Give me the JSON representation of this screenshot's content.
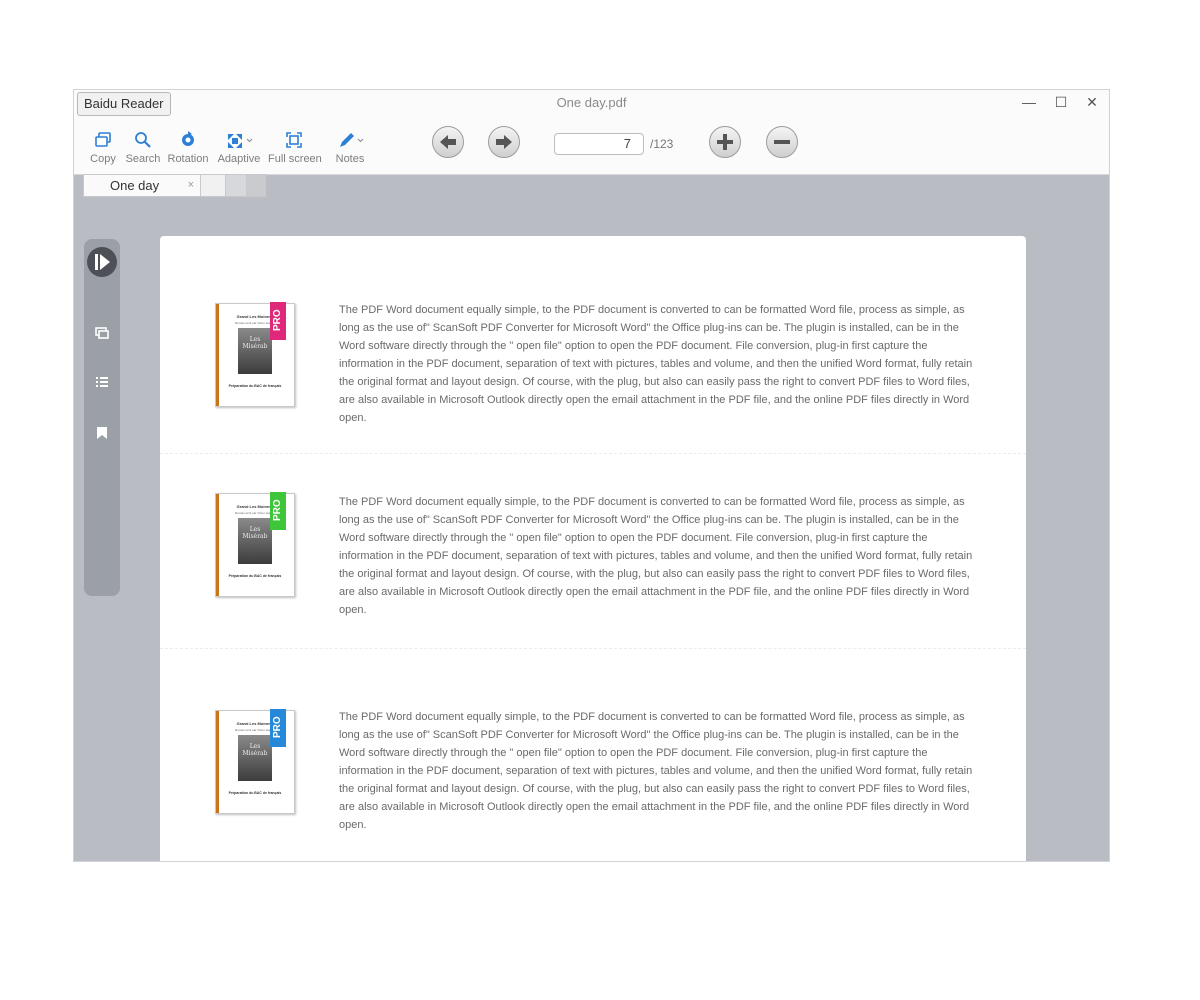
{
  "window": {
    "app_button": "Baidu Reader",
    "title": "One day.pdf",
    "controls": {
      "minimize": "—",
      "maximize": "☐",
      "close": "✕"
    }
  },
  "toolbar": {
    "copy": "Copy",
    "search": "Search",
    "rotation": "Rotation",
    "adaptive": "Adaptive",
    "fullscreen": "Full screen",
    "notes": "Notes"
  },
  "pager": {
    "current_page": "7",
    "total": "/123"
  },
  "tabs": [
    {
      "label": "One day",
      "close": "×"
    }
  ],
  "colors": {
    "accent": "#2e7fd6",
    "ribbon_pink": "#e0287a",
    "ribbon_green": "#3fc53a",
    "ribbon_blue": "#2688d8"
  },
  "entries": [
    {
      "ribbon": "PRO",
      "cover": {
        "title": "Grand Les Moines",
        "subtitle": "Roman écrit par Victor Hugo",
        "script": "Les Misérab",
        "footer": "Préparation du BAC de français"
      },
      "text": "The PDF Word document equally simple, to the PDF document is converted to can be formatted Word file, process as simple, as long as the use of\" ScanSoft PDF Converter for Microsoft Word\" the Office plug-ins can be. The plugin is installed, can be in the Word software directly through the \" open file\" option to open the PDF document. File conversion, plug-in first capture the information in the PDF document, separation of text with pictures, tables and volume, and then the unified Word format, fully retain the original format and layout design. Of course, with the plug, but also can easily pass the right to convert PDF files to Word files, are also available in Microsoft Outlook directly open the email attachment in the PDF file, and the online PDF files directly in Word open."
    },
    {
      "ribbon": "PRO",
      "cover": {
        "title": "Grand Les Moines",
        "subtitle": "Roman écrit par Victor Hugo",
        "script": "Les Misérab",
        "footer": "Préparation du BAC de français"
      },
      "text": "The PDF Word document equally simple, to the PDF document is converted to can be formatted Word file, process as simple, as long as the use of\" ScanSoft PDF Converter for Microsoft Word\" the Office plug-ins can be. The plugin is installed, can be in the Word software directly through the \" open file\" option to open the PDF document. File conversion, plug-in first capture the information in the PDF document, separation of text with pictures, tables and volume, and then the unified Word format, fully retain the original format and layout design. Of course, with the plug, but also can easily pass the right to convert PDF files to Word files, are also available in Microsoft Outlook directly open the email attachment in the PDF file, and the online PDF files directly in Word open."
    },
    {
      "ribbon": "PRO",
      "cover": {
        "title": "Grand Les Moines",
        "subtitle": "Roman écrit par Victor Hugo",
        "script": "Les Misérab",
        "footer": "Préparation du BAC de français"
      },
      "text": "The PDF Word document equally simple, to the PDF document is converted to can be formatted Word file, process as simple, as long as the use of\" ScanSoft PDF Converter for Microsoft Word\" the Office plug-ins can be. The plugin is installed, can be in the Word software directly through the \" open file\" option to open the PDF document. File conversion, plug-in first capture the information in the PDF document, separation of text with pictures, tables and volume, and then the unified Word format, fully retain the original format and layout design. Of course, with the plug, but also can easily pass the right to convert PDF files to Word files, are also available in Microsoft Outlook directly open the email attachment in the PDF file, and the online PDF files directly in Word open."
    }
  ]
}
